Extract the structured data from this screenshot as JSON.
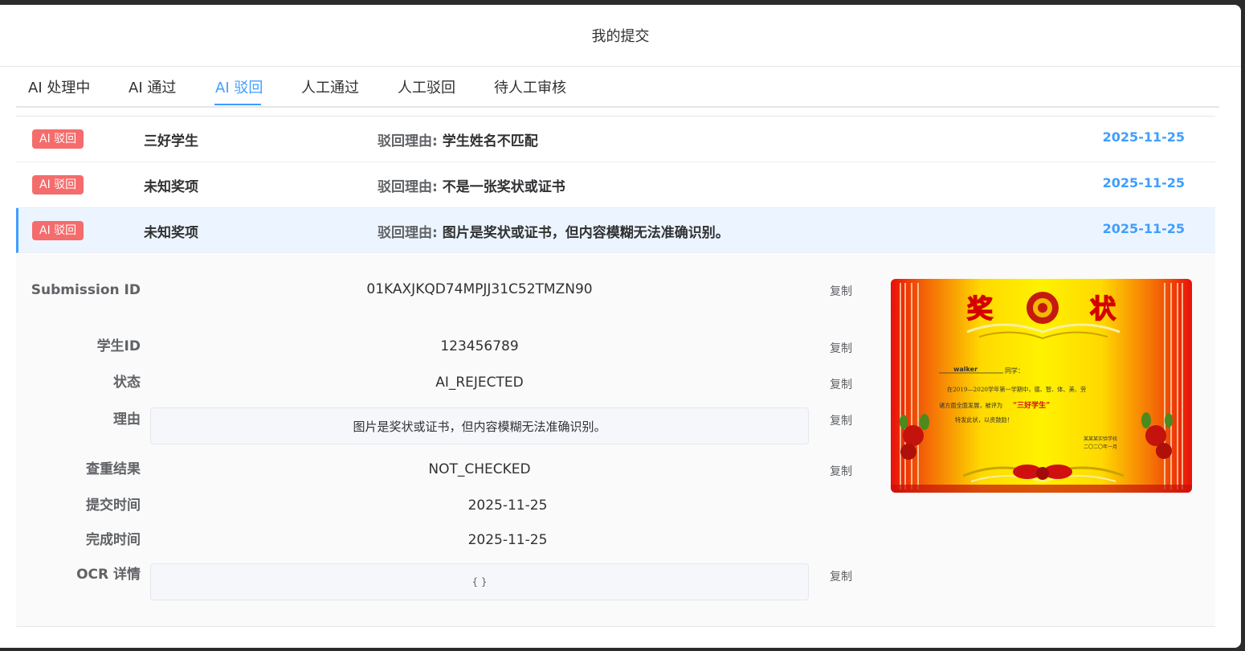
{
  "window": {
    "title": "我的提交"
  },
  "tabs": [
    {
      "label": "AI 处理中"
    },
    {
      "label": "AI 通过"
    },
    {
      "label": "AI 驳回"
    },
    {
      "label": "人工通过"
    },
    {
      "label": "人工驳回"
    },
    {
      "label": "待人工审核"
    }
  ],
  "active_tab": "AI 驳回",
  "submissions": [
    {
      "badge": "AI 驳回",
      "award": "三好学生",
      "reason_label": "驳回理由:",
      "reason": "学生姓名不匹配",
      "date": "2025-11-25"
    },
    {
      "badge": "AI 驳回",
      "award": "未知奖项",
      "reason_label": "驳回理由:",
      "reason": "不是一张奖状或证书",
      "date": "2025-11-25"
    },
    {
      "badge": "AI 驳回",
      "award": "未知奖项",
      "reason_label": "驳回理由:",
      "reason": "图片是奖状或证书，但内容模糊无法准确识别。",
      "date": "2025-11-25"
    }
  ],
  "detail": {
    "submission_id_label": "Submission ID",
    "submission_id": "01KAXJKQD74MPJJ31C52TMZN90",
    "student_id_label": "学生ID",
    "student_id": "123456789",
    "status_label": "状态",
    "status": "AI_REJECTED",
    "reason_label": "理由",
    "reason": "图片是奖状或证书，但内容模糊无法准确识别。",
    "dup_label": "查重结果",
    "dup": "NOT_CHECKED",
    "submit_time_label": "提交时间",
    "submit_time": "2025-11-25",
    "finish_time_label": "完成时间",
    "finish_time": "2025-11-25",
    "ocr_label": "OCR 详情",
    "ocr": "{ }",
    "copy_label": "复制"
  },
  "certificate": {
    "heading_left": "奖",
    "heading_right": "状",
    "name": "walker",
    "salutation": "同学：",
    "line1": "在2019—2020学年第一学期中，德、智、体、美、劳",
    "line2a": "诸方面全面发展，被评为",
    "line2b": "“三好学生”",
    "line3": "特发此状，以资鼓励！",
    "school": "某某某实验学校",
    "cert_date": "二〇二〇年一月"
  },
  "colors": {
    "accent": "#409eff",
    "badge": "#f56c6c",
    "selected_row_bg": "#ecf5ff"
  }
}
